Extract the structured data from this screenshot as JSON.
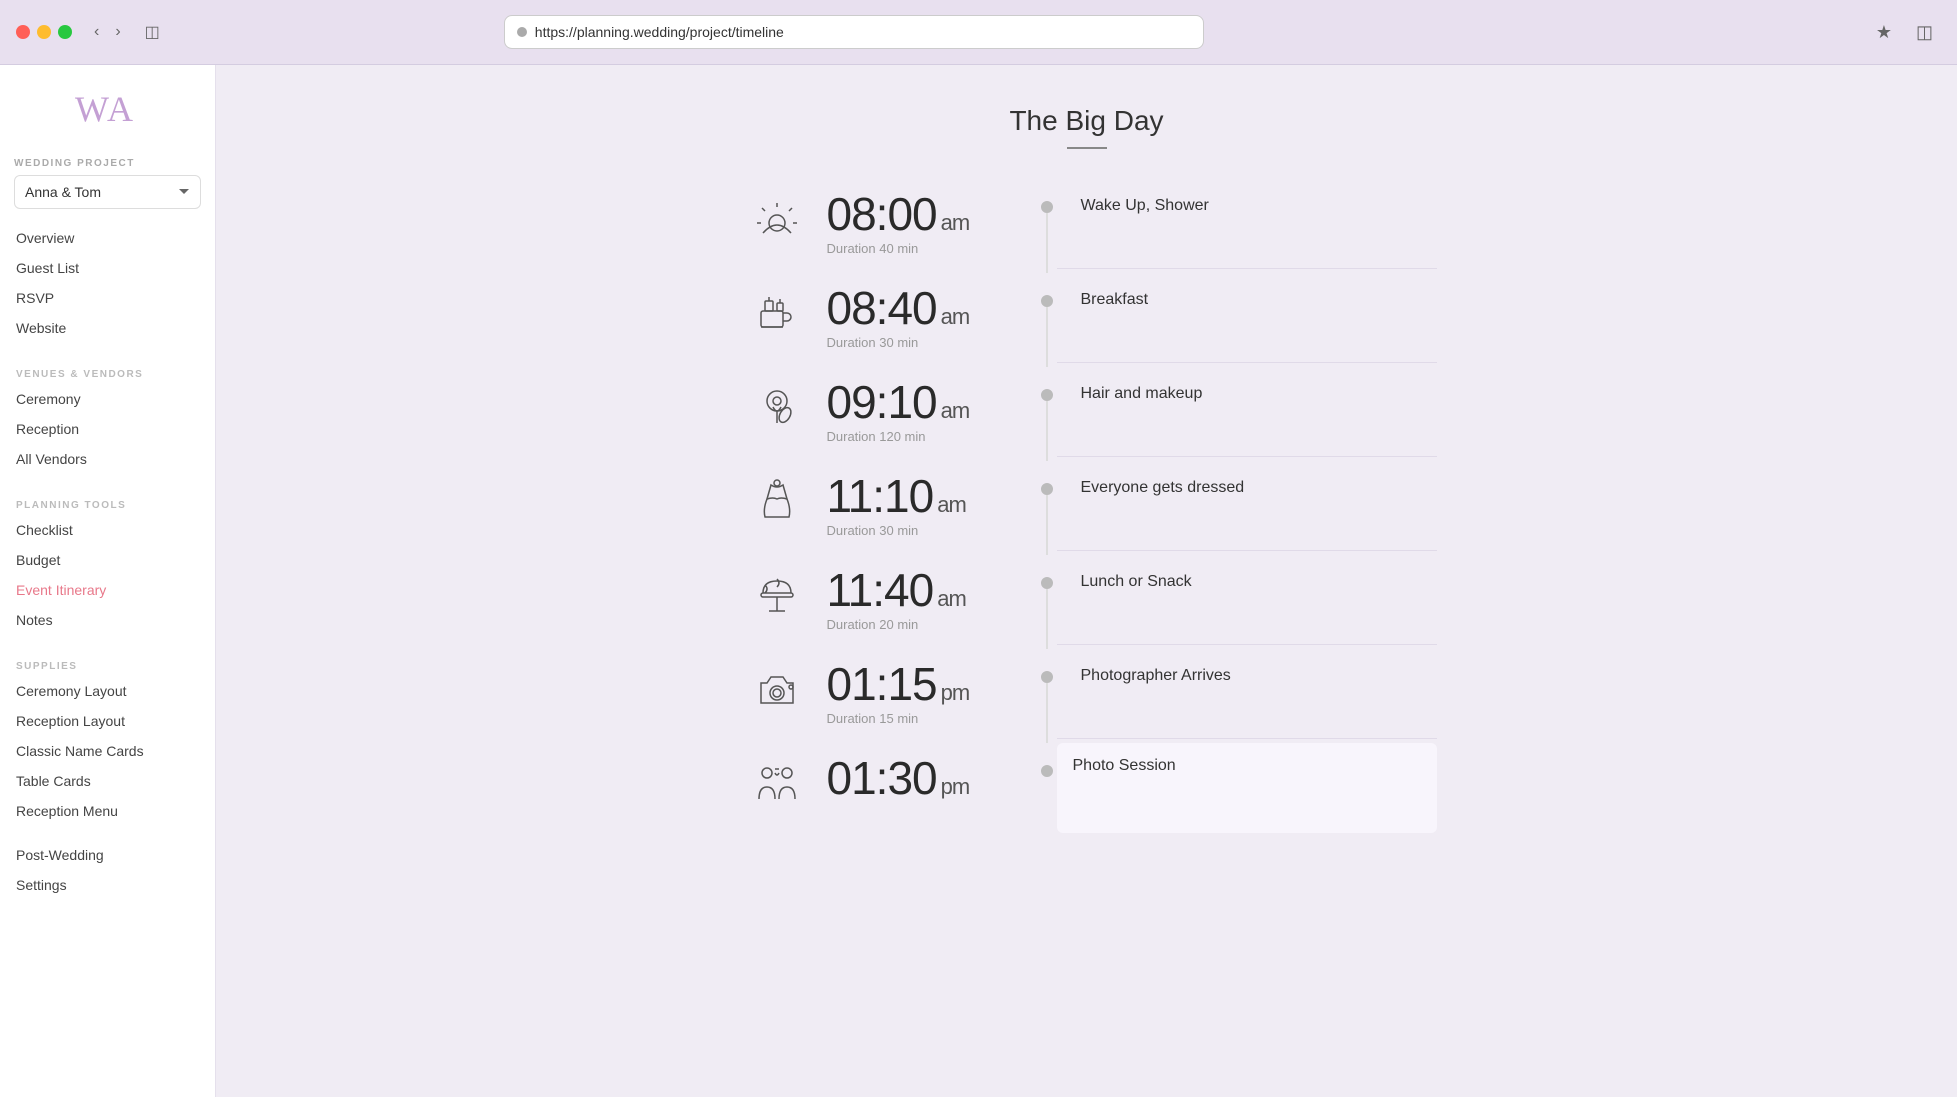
{
  "browser": {
    "url": "https://planning.wedding/project/timeline",
    "bookmark_icon": "★",
    "sidebar_icon": "⊡"
  },
  "sidebar": {
    "logo": "WA",
    "project_label": "WEDDING PROJECT",
    "project_name": "Anna & Tom",
    "nav_groups": [
      {
        "title": null,
        "items": [
          {
            "id": "overview",
            "label": "Overview",
            "active": false
          },
          {
            "id": "guest-list",
            "label": "Guest List",
            "active": false
          },
          {
            "id": "rsvp",
            "label": "RSVP",
            "active": false
          },
          {
            "id": "website",
            "label": "Website",
            "active": false
          }
        ]
      },
      {
        "title": "VENUES & VENDORS",
        "items": [
          {
            "id": "ceremony",
            "label": "Ceremony",
            "active": false
          },
          {
            "id": "reception",
            "label": "Reception",
            "active": false
          },
          {
            "id": "all-vendors",
            "label": "All Vendors",
            "active": false
          }
        ]
      },
      {
        "title": "PLANNING TOOLS",
        "items": [
          {
            "id": "checklist",
            "label": "Checklist",
            "active": false
          },
          {
            "id": "budget",
            "label": "Budget",
            "active": false
          },
          {
            "id": "event-itinerary",
            "label": "Event Itinerary",
            "active": true
          },
          {
            "id": "notes",
            "label": "Notes",
            "active": false
          }
        ]
      },
      {
        "title": "SUPPLIES",
        "items": [
          {
            "id": "ceremony-layout",
            "label": "Ceremony Layout",
            "active": false
          },
          {
            "id": "reception-layout",
            "label": "Reception Layout",
            "active": false
          },
          {
            "id": "classic-name-cards",
            "label": "Classic Name Cards",
            "active": false
          },
          {
            "id": "table-cards",
            "label": "Table Cards",
            "active": false
          },
          {
            "id": "reception-menu",
            "label": "Reception Menu",
            "active": false
          }
        ]
      },
      {
        "title": null,
        "items": [
          {
            "id": "post-wedding",
            "label": "Post-Wedding",
            "active": false
          },
          {
            "id": "settings",
            "label": "Settings",
            "active": false
          }
        ]
      }
    ]
  },
  "main": {
    "page_title": "The Big Day",
    "timeline_items": [
      {
        "id": "wake-up",
        "time": "08:00",
        "ampm": "am",
        "duration": "Duration 40 min",
        "event": "Wake Up, Shower",
        "icon": "sunrise"
      },
      {
        "id": "breakfast",
        "time": "08:40",
        "ampm": "am",
        "duration": "Duration 30 min",
        "event": "Breakfast",
        "icon": "coffee"
      },
      {
        "id": "hair-makeup",
        "time": "09:10",
        "ampm": "am",
        "duration": "Duration 120 min",
        "event": "Hair and makeup",
        "icon": "makeup"
      },
      {
        "id": "dressed",
        "time": "11:10",
        "ampm": "am",
        "duration": "Duration 30 min",
        "event": "Everyone gets dressed",
        "icon": "dress"
      },
      {
        "id": "lunch",
        "time": "11:40",
        "ampm": "am",
        "duration": "Duration 20 min",
        "event": "Lunch or Snack",
        "icon": "food"
      },
      {
        "id": "photographer",
        "time": "01:15",
        "ampm": "pm",
        "duration": "Duration 15 min",
        "event": "Photographer Arrives",
        "icon": "camera"
      },
      {
        "id": "photo-session",
        "time": "01:30",
        "ampm": "pm",
        "duration": "",
        "event": "Photo Session",
        "icon": "people-photo"
      }
    ]
  }
}
